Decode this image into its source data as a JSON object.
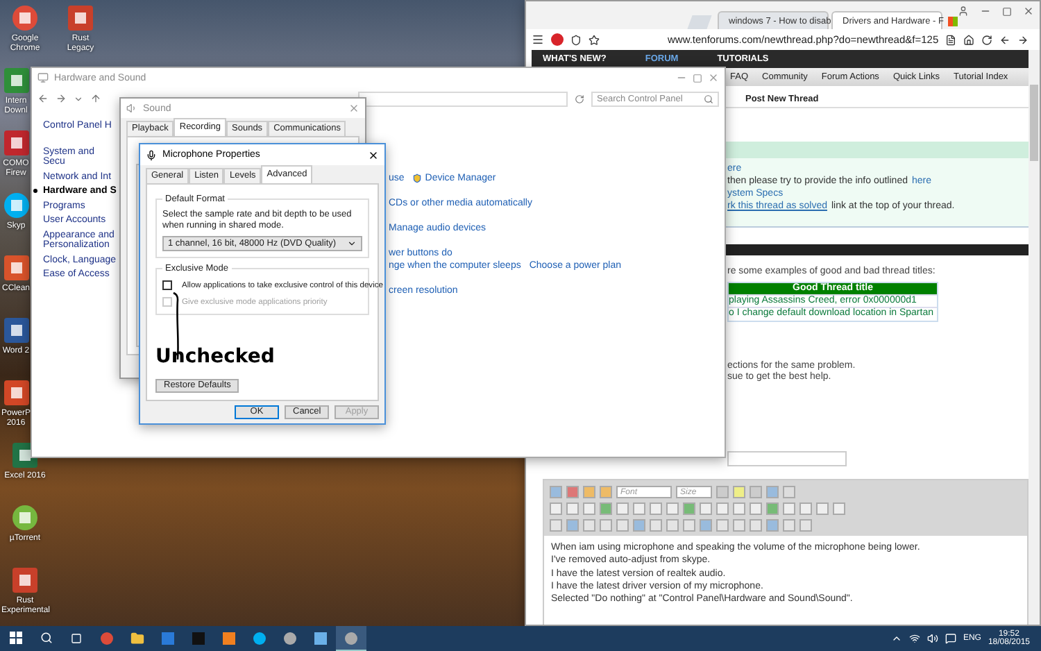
{
  "desktop": {
    "icons": [
      {
        "label": "Google Chrome",
        "kind": "chrome"
      },
      {
        "label": "Rust Legacy",
        "kind": "rust"
      },
      {
        "label": "Intern Downl",
        "kind": "download"
      },
      {
        "label": "COMO Firew",
        "kind": "comodo"
      },
      {
        "label": "Skyp",
        "kind": "skype"
      },
      {
        "label": "CClean",
        "kind": "ccleaner"
      },
      {
        "label": "Word 2",
        "kind": "word"
      },
      {
        "label": "PowerP 2016",
        "kind": "powerpoint"
      },
      {
        "label": "Excel 2016",
        "kind": "excel"
      },
      {
        "label": "µTorrent",
        "kind": "utorrent"
      },
      {
        "label": "Rust Experimental",
        "kind": "rust"
      }
    ]
  },
  "browser": {
    "tabs": [
      {
        "label": "windows 7 - How to disab",
        "selected": false
      },
      {
        "label": "Drivers and Hardware - F",
        "selected": true
      }
    ],
    "address": "www.tenforums.com/newthread.php?do=newthread&f=125",
    "nav": [
      {
        "label": "WHAT'S NEW?",
        "selected": false
      },
      {
        "label": "FORUM",
        "selected": true
      },
      {
        "label": "TUTORIALS",
        "selected": false
      }
    ],
    "menu": [
      "FAQ",
      "Community",
      "Forum Actions",
      "Quick Links",
      "Tutorial Index"
    ],
    "breadcrumb": "Post New Thread",
    "notice_lines": [
      [
        {
          "text": "ere",
          "link": true
        }
      ],
      [
        {
          "text": "then please try to provide the info outlined",
          "link": false
        },
        {
          "text": "here",
          "link": true
        }
      ],
      [
        {
          "text": "ystem Specs",
          "link": true
        }
      ],
      [
        {
          "text": "rk this thread as solved",
          "link": true
        },
        {
          "text": "link at the top of your thread.",
          "link": false
        }
      ]
    ],
    "examples_intro": "re some examples of good and bad thread titles:",
    "title_table": {
      "header": "Good Thread title",
      "rows": [
        "playing Assassins Creed, error 0x000000d1",
        "o I change default download location in Spartan"
      ]
    },
    "advice_lines": [
      "ections for the same problem.",
      "sue to get the best help."
    ],
    "editor": {
      "font_placeholder": "Font",
      "size_placeholder": "Size",
      "lines": [
        "When iam using microphone and speaking the volume of the microphone being lower.",
        "I've removed auto-adjust from skype.",
        "I have the latest version of realtek audio.",
        "I have the latest driver version of my microphone.",
        "Selected \"Do nothing\" at \"Control Panel\\Hardware and Sound\\Sound\"."
      ]
    }
  },
  "control_panel": {
    "title": "Hardware and Sound",
    "search_placeholder": "Search Control Panel",
    "sidebar": [
      {
        "label": "Control Panel H",
        "selected": false
      },
      {
        "label": "System and Secu",
        "selected": false
      },
      {
        "label": "Network and Int",
        "selected": false
      },
      {
        "label": "Hardware and S",
        "selected": true
      },
      {
        "label": "Programs",
        "selected": false
      },
      {
        "label": "User Accounts",
        "selected": false
      },
      {
        "label": "Appearance and Personalization",
        "selected": false
      },
      {
        "label": "Clock, Language",
        "selected": false
      },
      {
        "label": "Ease of Access",
        "selected": false
      }
    ],
    "content_groups": [
      {
        "rows": [
          {
            "links": [
              {
                "text": "use",
                "shield": false
              },
              {
                "text": "Device Manager",
                "shield": true
              }
            ]
          }
        ]
      },
      {
        "rows": [
          {
            "links": [
              {
                "text": "CDs or other media automatically",
                "shield": false
              }
            ]
          }
        ]
      },
      {
        "rows": [
          {
            "links": [
              {
                "text": "Manage audio devices",
                "shield": false
              }
            ]
          }
        ]
      },
      {
        "rows": [
          {
            "links": [
              {
                "text": "wer buttons do",
                "shield": false
              }
            ]
          },
          {
            "links": [
              {
                "text": "nge when the computer sleeps",
                "shield": false
              },
              {
                "text": "Choose a power plan",
                "shield": false
              }
            ]
          }
        ]
      },
      {
        "rows": [
          {
            "links": [
              {
                "text": "creen resolution",
                "shield": false
              }
            ]
          }
        ]
      }
    ]
  },
  "sound_dialog": {
    "title": "Sound",
    "tabs": [
      {
        "label": "Playback",
        "selected": false
      },
      {
        "label": "Recording",
        "selected": true
      },
      {
        "label": "Sounds",
        "selected": false
      },
      {
        "label": "Communications",
        "selected": false
      }
    ]
  },
  "mic_dialog": {
    "title": "Microphone Properties",
    "tabs": [
      {
        "label": "General",
        "selected": false
      },
      {
        "label": "Listen",
        "selected": false
      },
      {
        "label": "Levels",
        "selected": false
      },
      {
        "label": "Advanced",
        "selected": true
      }
    ],
    "default_format": {
      "legend": "Default Format",
      "description": "Select the sample rate and bit depth to be used when running in shared mode.",
      "value": "1 channel, 16 bit, 48000 Hz (DVD Quality)"
    },
    "exclusive_mode": {
      "legend": "Exclusive Mode",
      "options": [
        {
          "label": "Allow applications to take exclusive control of this device",
          "checked": false,
          "disabled": false
        },
        {
          "label": "Give exclusive mode applications priority",
          "checked": false,
          "disabled": true
        }
      ]
    },
    "annotation": "Unchecked",
    "restore_button": "Restore Defaults",
    "buttons": [
      {
        "label": "OK",
        "primary": true,
        "disabled": false
      },
      {
        "label": "Cancel",
        "primary": false,
        "disabled": false
      },
      {
        "label": "Apply",
        "primary": false,
        "disabled": true
      }
    ]
  },
  "taskbar": {
    "apps": [
      {
        "kind": "chrome",
        "selected": false
      },
      {
        "kind": "folder",
        "selected": false
      },
      {
        "kind": "g-blue",
        "selected": false
      },
      {
        "kind": "terminal",
        "selected": false
      },
      {
        "kind": "g-orange",
        "selected": false
      },
      {
        "kind": "skype",
        "selected": false
      },
      {
        "kind": "disc",
        "selected": false
      },
      {
        "kind": "window",
        "selected": false
      },
      {
        "kind": "disc",
        "selected": true
      }
    ],
    "language": "ENG",
    "time": "19:52",
    "date": "18/08/2015"
  }
}
